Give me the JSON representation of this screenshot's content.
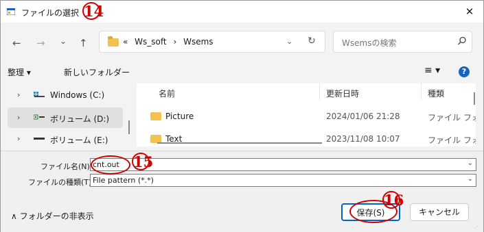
{
  "window": {
    "title": "ファイルの選択",
    "close_glyph": "✕"
  },
  "nav": {
    "back": "←",
    "forward": "→",
    "recent": "⌄",
    "up": "↑",
    "address": {
      "overflow": "«",
      "path": [
        "Ws_soft",
        "Wsems"
      ],
      "separator": "›",
      "dropdown_glyph": "⌄",
      "refresh_glyph": "↻"
    },
    "search": {
      "placeholder": "Wsemsの検索"
    }
  },
  "toolbar": {
    "organize_label": "整理 ▾",
    "new_folder_label": "新しいフォルダー",
    "view_glyph": "≡ ▾",
    "help_glyph": "?"
  },
  "sidebar": {
    "items": [
      {
        "chevron": "›",
        "label": "Windows (C:)",
        "icon": "windows-drive-icon"
      },
      {
        "chevron": "›",
        "label": "ボリューム (D:)",
        "icon": "usb-drive-icon",
        "selected": true
      },
      {
        "chevron": "›",
        "label": "ボリューム (E:)",
        "icon": "drive-icon"
      }
    ]
  },
  "file_list": {
    "columns": [
      "名前",
      "更新日時",
      "種類"
    ],
    "rows": [
      {
        "name": "Picture",
        "modified": "2024/01/06 21:28",
        "type": "ファイル フォ"
      },
      {
        "name": "Text",
        "modified": "2023/11/08 10:07",
        "type": "ファイル フォ"
      }
    ]
  },
  "form": {
    "filename_label": "ファイル名(N):",
    "filename_value": "cnt.out",
    "filetype_label": "ファイルの種類(T):",
    "filetype_value": "File pattern (*.*)"
  },
  "footer": {
    "hide_folders_label": "∧ フォルダーの非表示",
    "save_label": "保存(S)",
    "cancel_label": "キャンセル"
  },
  "annotations": {
    "n14": "14",
    "n15": "15",
    "n16": "16",
    "color": "#d00000"
  },
  "colors": {
    "accent": "#0067c0",
    "folder": "#f2c14e",
    "help": "#1565c0"
  }
}
